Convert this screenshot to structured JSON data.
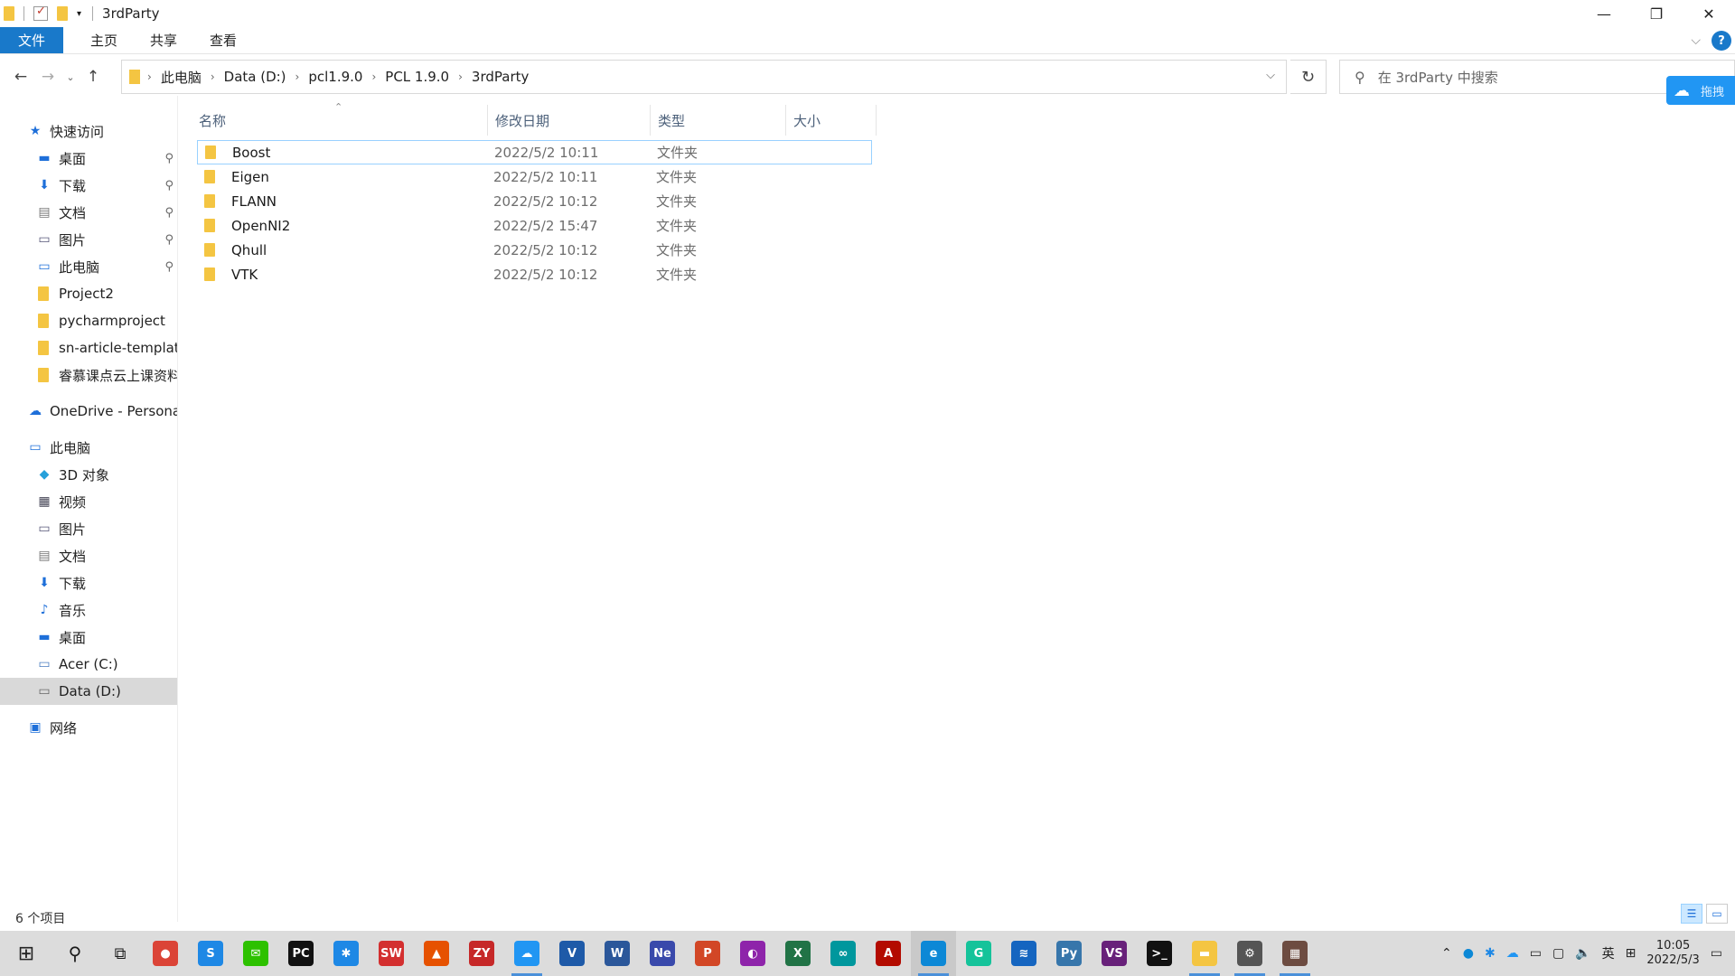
{
  "window": {
    "title": "3rdParty",
    "controls": {
      "minimize": "—",
      "restore": "❐",
      "close": "✕"
    }
  },
  "ribbon": {
    "tabs": [
      "文件",
      "主页",
      "共享",
      "查看"
    ]
  },
  "nav": {
    "back": "←",
    "forward": "→",
    "recent": "⌄",
    "up": "↑",
    "breadcrumbs": [
      "此电脑",
      "Data (D:)",
      "pcl1.9.0",
      "PCL 1.9.0",
      "3rdParty"
    ],
    "refresh": "↻",
    "search_placeholder": "在 3rdParty 中搜索"
  },
  "float_button": {
    "label": "拖拽"
  },
  "sidebar": {
    "quick_access": {
      "label": "快速访问",
      "items": [
        {
          "label": "桌面",
          "icon": "desktop-icon",
          "pinned": true
        },
        {
          "label": "下载",
          "icon": "download-icon",
          "pinned": true
        },
        {
          "label": "文档",
          "icon": "document-icon",
          "pinned": true
        },
        {
          "label": "图片",
          "icon": "pictures-icon",
          "pinned": true
        },
        {
          "label": "此电脑",
          "icon": "computer-icon",
          "pinned": true
        },
        {
          "label": "Project2",
          "icon": "folder-icon",
          "pinned": false
        },
        {
          "label": "pycharmproject",
          "icon": "folder-icon",
          "pinned": false
        },
        {
          "label": "sn-article-templat",
          "icon": "folder-icon",
          "pinned": false
        },
        {
          "label": "睿慕课点云上课资料",
          "icon": "folder-icon",
          "pinned": false
        }
      ]
    },
    "onedrive": {
      "label": "OneDrive - Persona"
    },
    "this_pc": {
      "label": "此电脑",
      "items": [
        {
          "label": "3D 对象",
          "icon": "3d-objects-icon"
        },
        {
          "label": "视频",
          "icon": "video-icon"
        },
        {
          "label": "图片",
          "icon": "pictures-icon"
        },
        {
          "label": "文档",
          "icon": "document-icon"
        },
        {
          "label": "下载",
          "icon": "download-icon"
        },
        {
          "label": "音乐",
          "icon": "music-icon"
        },
        {
          "label": "桌面",
          "icon": "desktop-icon"
        },
        {
          "label": "Acer (C:)",
          "icon": "drive-icon"
        },
        {
          "label": "Data (D:)",
          "icon": "drive-icon",
          "selected": true
        }
      ]
    },
    "network": {
      "label": "网络"
    }
  },
  "columns": [
    "名称",
    "修改日期",
    "类型",
    "大小"
  ],
  "files": [
    {
      "name": "Boost",
      "modified": "2022/5/2 10:11",
      "type": "文件夹",
      "selected": true
    },
    {
      "name": "Eigen",
      "modified": "2022/5/2 10:11",
      "type": "文件夹"
    },
    {
      "name": "FLANN",
      "modified": "2022/5/2 10:12",
      "type": "文件夹"
    },
    {
      "name": "OpenNI2",
      "modified": "2022/5/2 15:47",
      "type": "文件夹"
    },
    {
      "name": "Qhull",
      "modified": "2022/5/2 10:12",
      "type": "文件夹"
    },
    {
      "name": "VTK",
      "modified": "2022/5/2 10:12",
      "type": "文件夹"
    }
  ],
  "status": {
    "item_count": "6 个项目"
  },
  "taskbar": {
    "apps": [
      {
        "name": "chrome-icon",
        "color": "#db4437",
        "glyph": "●"
      },
      {
        "name": "sogou-icon",
        "color": "#1e88e5",
        "glyph": "S"
      },
      {
        "name": "wechat-icon",
        "color": "#2dc100",
        "glyph": "✉"
      },
      {
        "name": "pycharm-icon",
        "color": "#111111",
        "glyph": "PC"
      },
      {
        "name": "app-star-icon",
        "color": "#1e88e5",
        "glyph": "✱"
      },
      {
        "name": "solidworks-icon",
        "color": "#d32f2f",
        "glyph": "SW"
      },
      {
        "name": "matlab-icon",
        "color": "#e65100",
        "glyph": "▲"
      },
      {
        "name": "zy-icon",
        "color": "#c62828",
        "glyph": "ZY"
      },
      {
        "name": "baidu-netdisk-icon",
        "color": "#2196f3",
        "glyph": "☁"
      },
      {
        "name": "visio-icon",
        "color": "#1e5aa8",
        "glyph": "V"
      },
      {
        "name": "word-icon",
        "color": "#2b579a",
        "glyph": "W"
      },
      {
        "name": "note-icon",
        "color": "#3949ab",
        "glyph": "Ne"
      },
      {
        "name": "powerpoint-icon",
        "color": "#d24726",
        "glyph": "P"
      },
      {
        "name": "app-purple-icon",
        "color": "#8e24aa",
        "glyph": "◐"
      },
      {
        "name": "excel-icon",
        "color": "#217346",
        "glyph": "X"
      },
      {
        "name": "arduino-icon",
        "color": "#00979d",
        "glyph": "∞"
      },
      {
        "name": "acrobat-icon",
        "color": "#b30b00",
        "glyph": "A"
      },
      {
        "name": "edge-icon",
        "color": "#0c88d6",
        "glyph": "e"
      },
      {
        "name": "grammarly-icon",
        "color": "#15c39a",
        "glyph": "G"
      },
      {
        "name": "cloud-app-icon",
        "color": "#1565c0",
        "glyph": "≋"
      },
      {
        "name": "python-icon",
        "color": "#3776ab",
        "glyph": "Py"
      },
      {
        "name": "visual-studio-icon",
        "color": "#68217a",
        "glyph": "VS"
      },
      {
        "name": "terminal-icon",
        "color": "#111111",
        "glyph": ">_"
      },
      {
        "name": "file-explorer-icon",
        "color": "#f4c542",
        "glyph": "▬"
      },
      {
        "name": "settings-icon",
        "color": "#555555",
        "glyph": "⚙"
      },
      {
        "name": "photo-app-icon",
        "color": "#6d4c41",
        "glyph": "▦"
      }
    ],
    "time": "10:05",
    "date": "2022/5/3"
  }
}
